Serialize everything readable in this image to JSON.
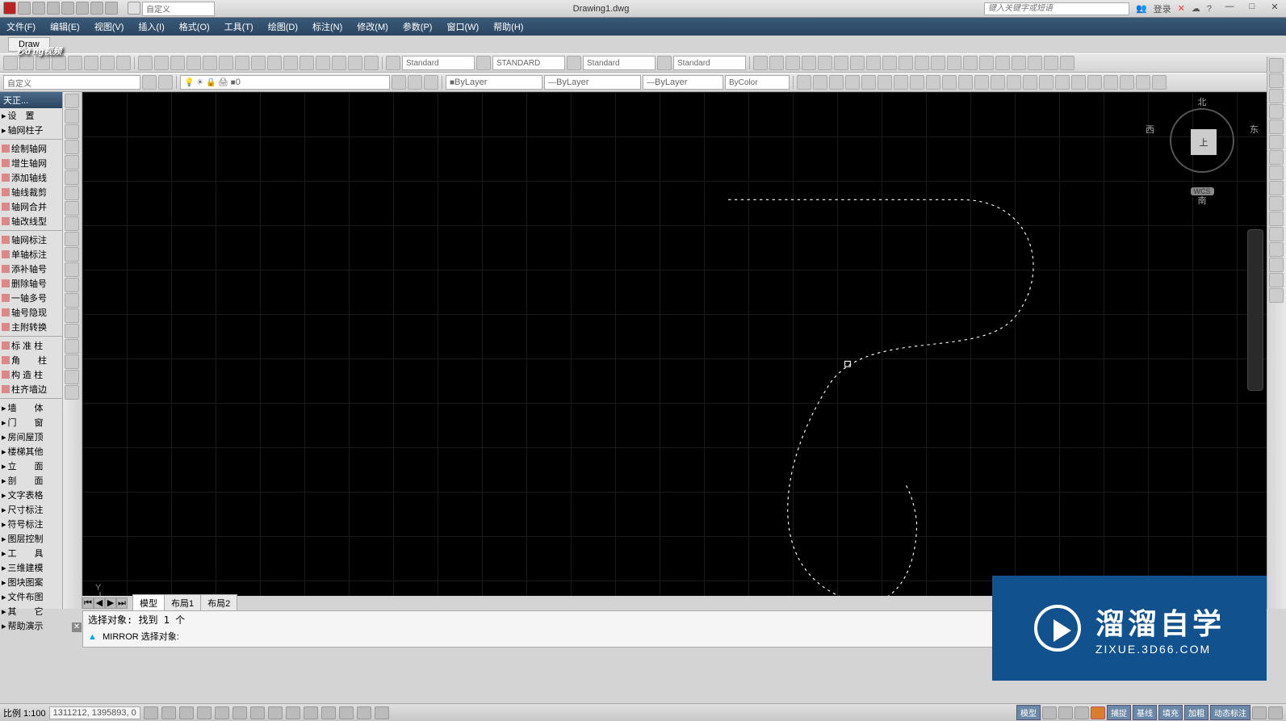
{
  "titlebar": {
    "title": "Drawing1.dwg",
    "search_placeholder": "键入关键字或短语",
    "login": "登录",
    "workspace": "自定义"
  },
  "menus": [
    "文件(F)",
    "编辑(E)",
    "视图(V)",
    "插入(I)",
    "格式(O)",
    "工具(T)",
    "绘图(D)",
    "标注(N)",
    "修改(M)",
    "参数(P)",
    "窗口(W)",
    "帮助(H)"
  ],
  "doc_tab": "Draw",
  "styles": {
    "text": "Standard",
    "dim": "STANDARD",
    "ml": "Standard",
    "table": "Standard"
  },
  "layer": {
    "combo": "自定义",
    "layer_name": "0",
    "bylayer1": "ByLayer",
    "bylayer2": "ByLayer",
    "bylayer3": "ByLayer",
    "bycolor": "ByColor"
  },
  "left_panel": {
    "hdr": "天正...",
    "groups": [
      [
        "设　置",
        "轴网柱子"
      ],
      [
        "绘制轴网",
        "增生轴网",
        "添加轴线",
        "轴线裁剪",
        "轴网合并",
        "轴改线型"
      ],
      [
        "轴网标注",
        "单轴标注",
        "添补轴号",
        "删除轴号",
        "一轴多号",
        "轴号隐现",
        "主附转换"
      ],
      [
        "标 准 柱",
        "角　　柱",
        "构 造 柱",
        "柱齐墙边"
      ],
      [
        "墙　　体",
        "门　　窗",
        "房间屋顶",
        "楼梯其他",
        "立　　面",
        "剖　　面",
        "文字表格",
        "尺寸标注",
        "符号标注",
        "图层控制",
        "工　　具",
        "三维建模",
        "图块图案",
        "文件布图",
        "其　　它",
        "帮助演示"
      ]
    ]
  },
  "layout_tabs": {
    "model": "模型",
    "l1": "布局1",
    "l2": "布局2"
  },
  "cmd": {
    "line1": "选择对象: 找到 1 个",
    "line2": "MIRROR 选择对象:",
    "prompt_icon": "▶"
  },
  "status": {
    "scale": "比例 1:100",
    "coords": "1311212, 1395893, 0"
  },
  "viewcube": {
    "n": "北",
    "s": "南",
    "w": "西",
    "e": "东",
    "top": "上",
    "wcs": "WCS"
  },
  "watermark1": "秒d  ng视频",
  "brand": {
    "big": "溜溜自学",
    "small": "ZIXUE.3D66.COM"
  }
}
